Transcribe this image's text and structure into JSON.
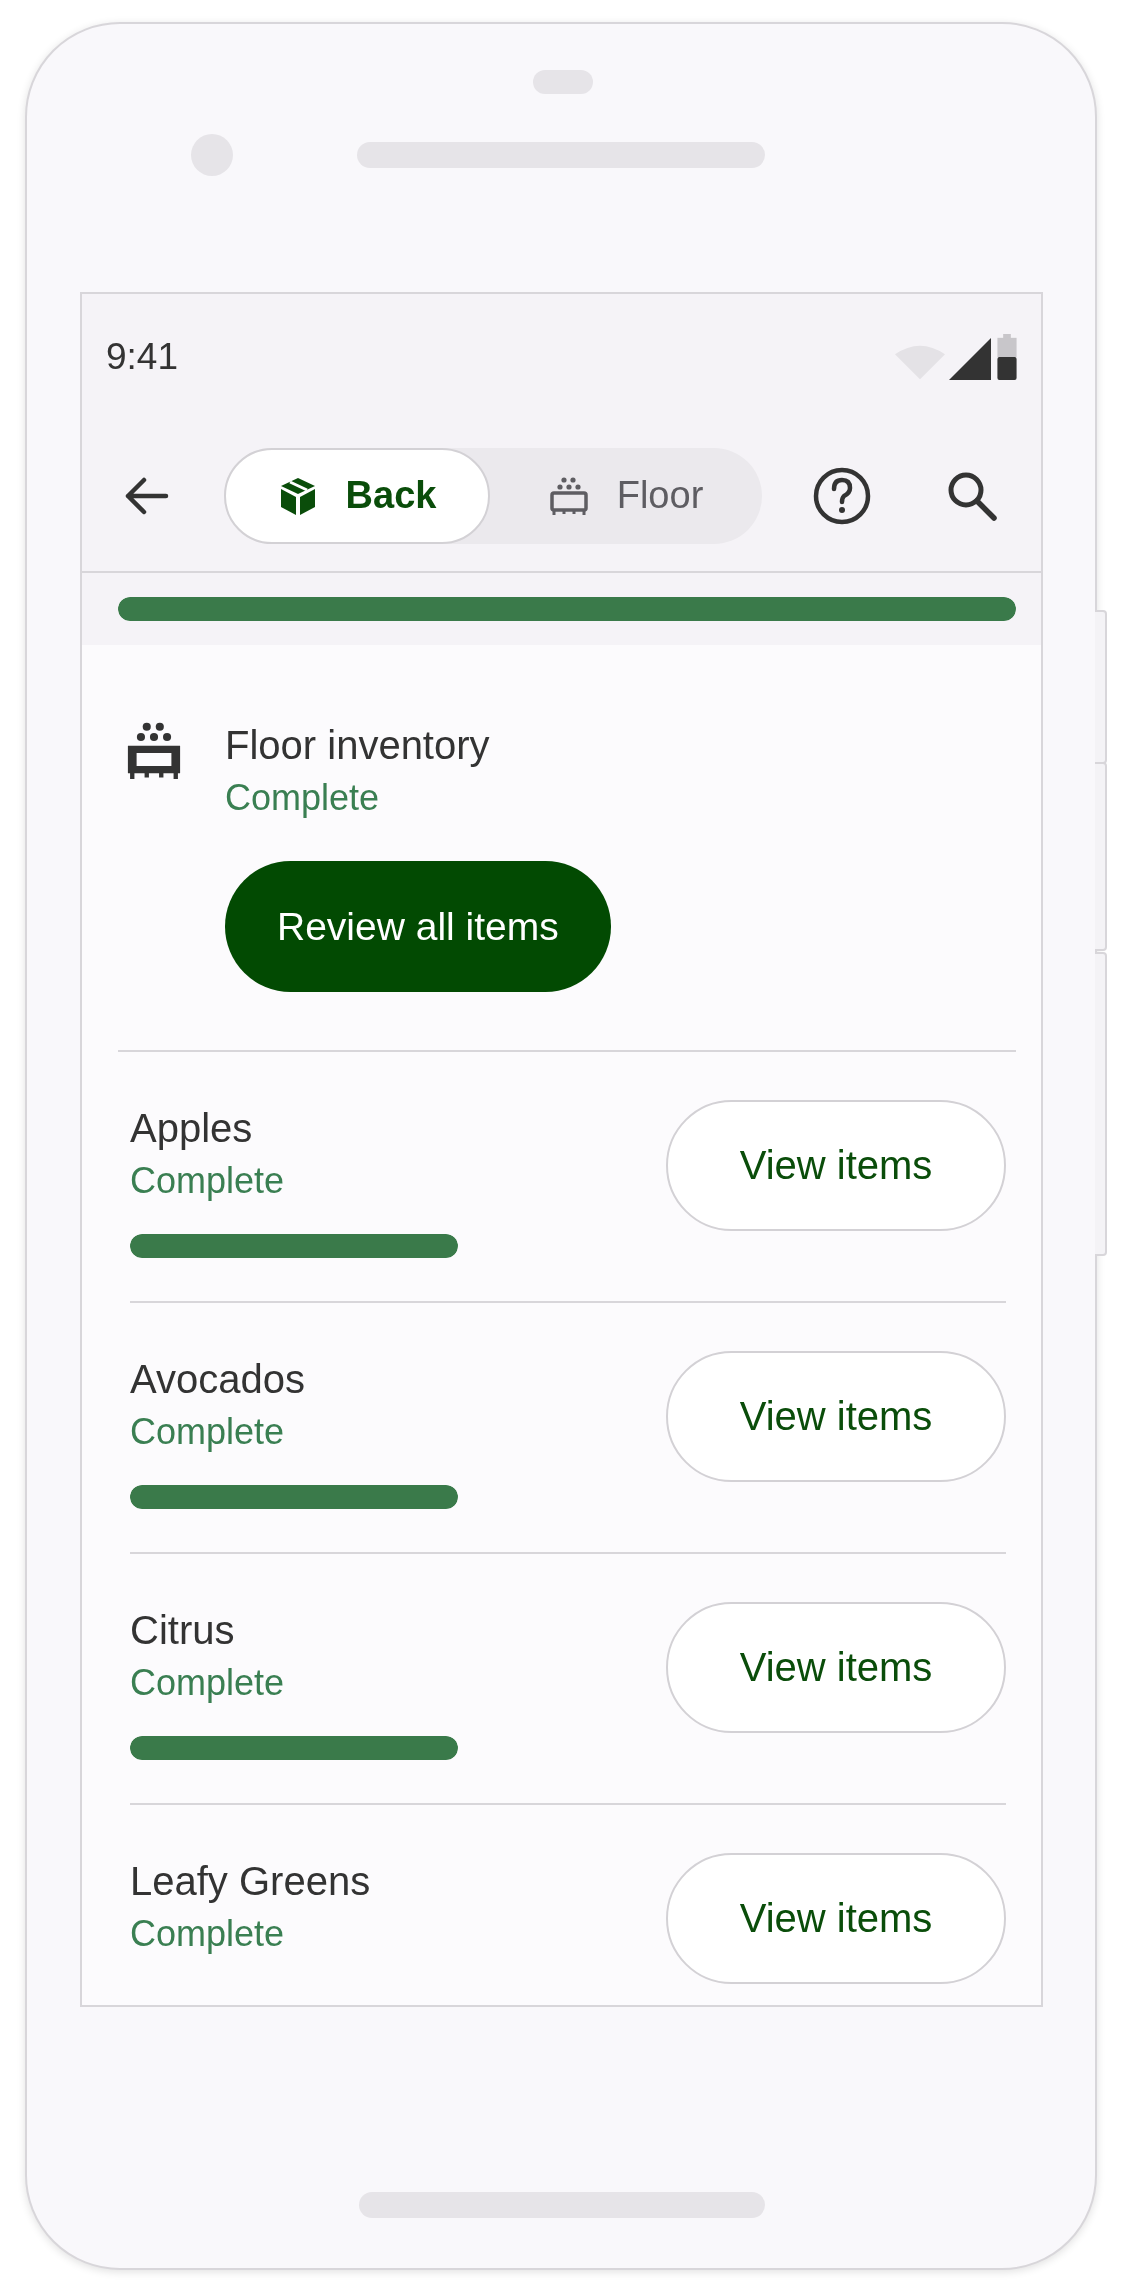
{
  "status_bar": {
    "time": "9:41"
  },
  "tabs": [
    {
      "label": "Back",
      "selected": true,
      "kind": "box"
    },
    {
      "label": "Floor",
      "selected": false,
      "kind": "shelf"
    }
  ],
  "overall_progress": {
    "level": 1
  },
  "section": {
    "title": "Floor inventory",
    "status": "Complete",
    "button": "Review all items"
  },
  "categories": [
    {
      "name": "Apples",
      "status": "Complete",
      "level": 1,
      "button": "View items"
    },
    {
      "name": "Avocados",
      "status": "Complete",
      "level": 1,
      "button": "View items"
    },
    {
      "name": "Citrus",
      "status": "Complete",
      "level": 1,
      "button": "View items"
    },
    {
      "name": "Leafy Greens",
      "status": "Complete",
      "button": "View items"
    }
  ]
}
